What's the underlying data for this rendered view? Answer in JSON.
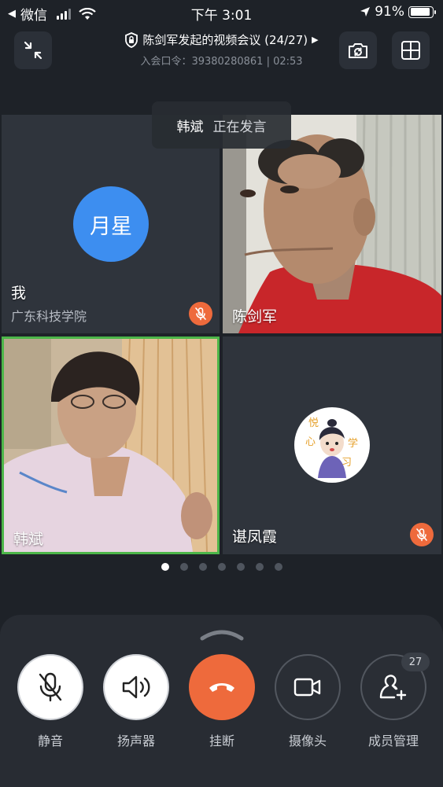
{
  "status_bar": {
    "back_app": "微信",
    "time": "下午 3:01",
    "battery_text": "91%",
    "battery_level": 0.91
  },
  "header": {
    "title": "陈剑军发起的视频会议 (24/27)",
    "subtitle": "入会口令：39380280861 | 02:53"
  },
  "speaking_toast": {
    "name": "韩斌",
    "status": "正在发言"
  },
  "tiles": {
    "self": {
      "avatar_text": "月星",
      "name": "我",
      "org": "广东科技学院",
      "muted": true
    },
    "tile2": {
      "name": "陈剑军",
      "muted": false
    },
    "tile3": {
      "name": "韩斌",
      "speaking": true,
      "muted": false
    },
    "tile4": {
      "name": "谌凤霞",
      "muted": true
    }
  },
  "pagination": {
    "pages": 7,
    "current": 1
  },
  "controls": {
    "mute_label": "静音",
    "speaker_label": "扬声器",
    "hangup_label": "挂断",
    "camera_label": "摄像头",
    "members_label": "成员管理",
    "members_count": "27"
  },
  "icons": {
    "minimize": "collapse-arrows-icon",
    "lock": "lock-icon",
    "switch_camera": "switch-camera-icon",
    "layout": "grid-layout-icon",
    "mic_off": "mic-off-icon",
    "speaker": "speaker-icon",
    "hangup": "phone-hangup-icon",
    "camera": "video-camera-icon",
    "member_add": "member-add-icon"
  },
  "colors": {
    "background": "#1e2228",
    "tile": "#2f343c",
    "accent_blue": "#3d8ef0",
    "hangup_orange": "#ee6a3c",
    "speaking_border": "#4cb649"
  }
}
